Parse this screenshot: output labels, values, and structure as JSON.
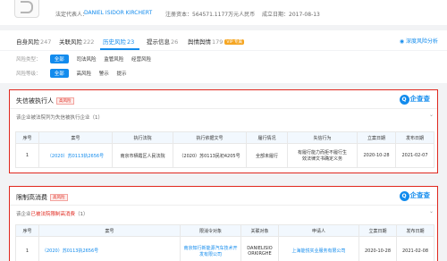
{
  "header": {
    "legal_rep_label": "法定代表人：",
    "legal_rep_name": "DANIEL ISIDOR KIRCHERT",
    "capital": "注册资本：564571.1177万元人民币",
    "founded": "成立日期：2017-08-13"
  },
  "tabs": [
    {
      "label": "自身风险",
      "count": "247"
    },
    {
      "label": "关联风险",
      "count": "222"
    },
    {
      "label": "历史风险",
      "count": "23"
    },
    {
      "label": "提示信息",
      "count": "26"
    },
    {
      "label": "舆情舆情",
      "count": "179"
    }
  ],
  "tabs_vip": "VIP 专属",
  "deep_link": "深度风险分析",
  "filters": {
    "type_label": "风险类型：",
    "type_options": [
      "全部",
      "司法风险",
      "监管风险",
      "经营风险"
    ],
    "level_label": "风险等级：",
    "level_options": [
      "全部",
      "高风险",
      "警示",
      "提示"
    ]
  },
  "section1": {
    "title": "失信被执行人",
    "tag": "高风险",
    "brand": "企查查",
    "brand_icon": "Q",
    "desc": "该企业被法院列为失信被执行企业（1）",
    "headers": [
      "序号",
      "案号",
      "执行法院",
      "执行依据文号",
      "履行情况",
      "失信行为",
      "立案日期",
      "发布日期"
    ],
    "row": {
      "no": "1",
      "case": "（2020）苏0113执2656号",
      "court": "南京市栖霞区人民法院",
      "basis": "（2020）苏0113民初4205号",
      "status": "全部未履行",
      "behavior_1": "有履行能力而拒不履行生",
      "behavior_2": "效法律文书确定义务",
      "filed": "2020-10-28",
      "published": "2021-02-07"
    }
  },
  "section2": {
    "title": "限制高消费",
    "tag": "高风险",
    "brand": "企查查",
    "brand_icon": "Q",
    "desc_prefix": "该企业",
    "desc_highlight": "已被法院限制高消费",
    "desc_suffix": "（1）",
    "headers": [
      "序号",
      "案号",
      "限消令对象",
      "关联对象",
      "申请人",
      "立案日期",
      "发布日期"
    ],
    "row": {
      "no": "1",
      "case": "（2020）苏0113执2656号",
      "target_1": "南京知行新能源汽车技术开",
      "target_2": "发有限公司",
      "related_1": "DANIELISIO",
      "related_2": "ORKIRGHE",
      "applicant": "上海能悦实业服务有限公司",
      "filed": "2020-10-28",
      "published": "2021-02-08"
    }
  }
}
